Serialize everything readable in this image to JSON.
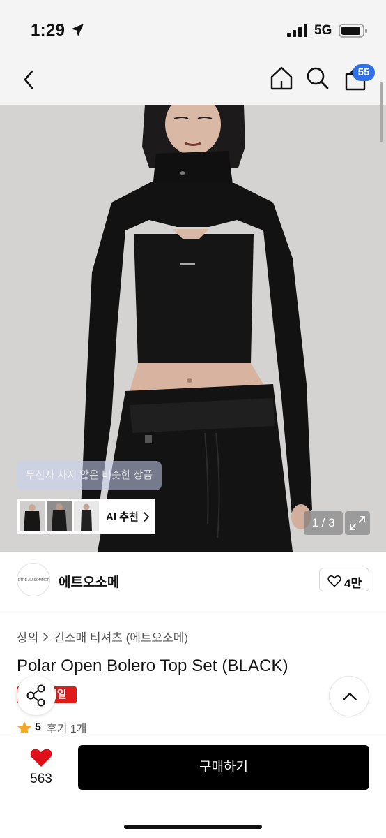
{
  "status_bar": {
    "time": "1:29",
    "network": "5G"
  },
  "nav": {
    "cart_badge": "55"
  },
  "hero": {
    "ghost_button": "무신사 사지 않은 비슷한 상품",
    "ai_recommend_label": "AI 추천",
    "page_counter": "1 / 3"
  },
  "brand": {
    "name": "에트오소메",
    "logo_text": "ÊTRE AU SOMMET",
    "like_count": "4만"
  },
  "product": {
    "breadcrumb": [
      "상의",
      "긴소매 티셔츠 (에트오소메)"
    ],
    "title": "Polar Open Bolero Top Set (BLACK)",
    "sale_label": "세일",
    "rating": "5",
    "review_label": "후기 1개"
  },
  "bottom_bar": {
    "wish_count": "563",
    "buy_label": "구매하기"
  },
  "colors": {
    "accent": "#2f6fe8",
    "sale": "#e01b1b",
    "heart": "#e0101a",
    "buy": "#000000"
  }
}
